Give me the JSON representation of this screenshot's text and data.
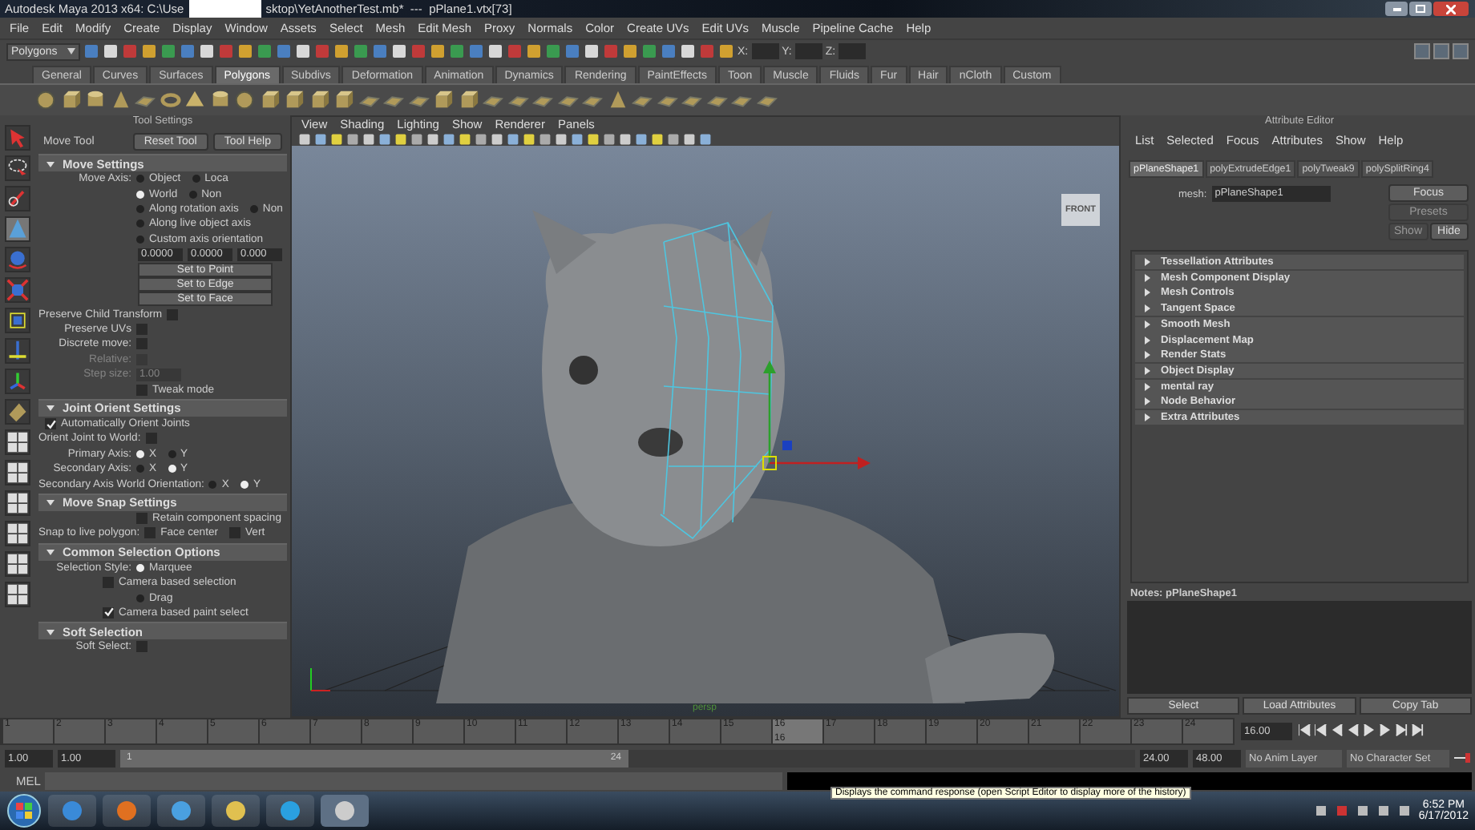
{
  "window": {
    "title_left": "Autodesk Maya 2013 x64: C:\\Use",
    "title_right": "sktop\\YetAnotherTest.mb*  ---  pPlane1.vtx[73]"
  },
  "menu": [
    "File",
    "Edit",
    "Modify",
    "Create",
    "Display",
    "Window",
    "Assets",
    "Select",
    "Mesh",
    "Edit Mesh",
    "Proxy",
    "Normals",
    "Color",
    "Create UVs",
    "Edit UVs",
    "Muscle",
    "Pipeline Cache",
    "Help"
  ],
  "status_line": {
    "mode": "Polygons",
    "coords": [
      "X:",
      "Y:",
      "Z:"
    ]
  },
  "shelf_tabs": [
    {
      "label": "General",
      "selected": false
    },
    {
      "label": "Curves",
      "selected": false
    },
    {
      "label": "Surfaces",
      "selected": false
    },
    {
      "label": "Polygons",
      "selected": true
    },
    {
      "label": "Subdivs",
      "selected": false
    },
    {
      "label": "Deformation",
      "selected": false
    },
    {
      "label": "Animation",
      "selected": false
    },
    {
      "label": "Dynamics",
      "selected": false
    },
    {
      "label": "Rendering",
      "selected": false
    },
    {
      "label": "PaintEffects",
      "selected": false
    },
    {
      "label": "Toon",
      "selected": false
    },
    {
      "label": "Muscle",
      "selected": false
    },
    {
      "label": "Fluids",
      "selected": false
    },
    {
      "label": "Fur",
      "selected": false
    },
    {
      "label": "Hair",
      "selected": false
    },
    {
      "label": "nCloth",
      "selected": false
    },
    {
      "label": "Custom",
      "selected": false
    }
  ],
  "tool_settings": {
    "title": "Tool Settings",
    "tool": "Move Tool",
    "buttons": [
      "Reset Tool",
      "Tool Help"
    ],
    "sections": [
      {
        "title": "Move Settings",
        "expanded": true,
        "rows": [
          {
            "kind": "radio",
            "label": "Move Axis:",
            "options": [
              {
                "text": "Object",
                "selected": false
              },
              {
                "text": "Loca",
                "selected": false
              }
            ]
          },
          {
            "kind": "radio",
            "options": [
              {
                "text": "World",
                "selected": true
              },
              {
                "text": "Non",
                "selected": false
              }
            ]
          },
          {
            "kind": "radio",
            "options": [
              {
                "text": "Along rotation axis",
                "selected": false
              },
              {
                "text": "Non",
                "selected": false
              }
            ]
          },
          {
            "kind": "radio",
            "options": [
              {
                "text": "Along live object axis",
                "selected": false
              }
            ]
          },
          {
            "kind": "radio",
            "options": [
              {
                "text": "Custom axis orientation",
                "selected": false
              }
            ]
          },
          {
            "kind": "fields",
            "values": [
              "0.0000",
              "0.0000",
              "0.000"
            ]
          },
          {
            "kind": "button",
            "text": "Set to Point"
          },
          {
            "kind": "button",
            "text": "Set to Edge"
          },
          {
            "kind": "button",
            "text": "Set to Face"
          },
          {
            "kind": "check",
            "label": "Preserve Child Transform",
            "items": [
              {
                "checked": false
              }
            ]
          },
          {
            "kind": "check",
            "label": "Preserve UVs",
            "items": [
              {
                "checked": false
              }
            ]
          },
          {
            "kind": "check",
            "label": "Discrete move:",
            "items": [
              {
                "checked": false
              }
            ]
          },
          {
            "kind": "check",
            "label": "Relative:",
            "disabled": true,
            "items": [
              {
                "checked": false
              }
            ]
          },
          {
            "kind": "field",
            "label": "Step size:",
            "disabled": true,
            "value": "1.00"
          },
          {
            "kind": "check",
            "items": [
              {
                "text": "Tweak mode",
                "checked": false
              }
            ]
          }
        ]
      },
      {
        "title": "Joint Orient Settings",
        "expanded": true,
        "rows": [
          {
            "kind": "check",
            "wide": true,
            "items": [
              {
                "text": "Automatically Orient Joints",
                "checked": true
              }
            ]
          },
          {
            "kind": "check",
            "label": "Orient Joint to World:",
            "items": [
              {
                "checked": false
              }
            ]
          },
          {
            "kind": "radio",
            "label": "Primary Axis:",
            "options": [
              {
                "text": "X",
                "selected": true
              },
              {
                "text": "Y",
                "selected": false
              }
            ]
          },
          {
            "kind": "radio",
            "label": "Secondary Axis:",
            "options": [
              {
                "text": "X",
                "selected": false
              },
              {
                "text": "Y",
                "selected": true
              }
            ]
          },
          {
            "kind": "radio",
            "label": "Secondary Axis World Orientation:",
            "options": [
              {
                "text": "X",
                "selected": false
              },
              {
                "text": "Y",
                "selected": true
              }
            ]
          }
        ]
      },
      {
        "title": "Move Snap Settings",
        "expanded": true,
        "rows": [
          {
            "kind": "check",
            "items": [
              {
                "text": "Retain component spacing",
                "checked": false
              }
            ]
          },
          {
            "kind": "check",
            "label": "Snap to live polygon:",
            "items": [
              {
                "text": "Face center",
                "checked": false
              },
              {
                "text": "Vert",
                "checked": false
              }
            ]
          }
        ]
      },
      {
        "title": "Common Selection Options",
        "expanded": true,
        "rows": [
          {
            "kind": "radio",
            "label": "Selection Style:",
            "options": [
              {
                "text": "Marquee",
                "selected": true
              }
            ]
          },
          {
            "kind": "check",
            "indent": true,
            "items": [
              {
                "text": "Camera based selection",
                "checked": false
              }
            ]
          },
          {
            "kind": "radio",
            "options": [
              {
                "text": "Drag",
                "selected": false
              }
            ]
          },
          {
            "kind": "check",
            "indent": true,
            "items": [
              {
                "text": "Camera based paint select",
                "checked": true
              }
            ]
          }
        ]
      },
      {
        "title": "Soft Selection",
        "expanded": true,
        "rows": [
          {
            "kind": "check",
            "label": "Soft Select:",
            "items": [
              {
                "checked": false
              }
            ]
          }
        ]
      }
    ]
  },
  "viewport": {
    "menu": [
      "View",
      "Shading",
      "Lighting",
      "Show",
      "Renderer",
      "Panels"
    ],
    "view_cube": "FRONT",
    "camera": "persp"
  },
  "attribute_editor": {
    "title": "Attribute Editor",
    "menu": [
      "List",
      "Selected",
      "Focus",
      "Attributes",
      "Show",
      "Help"
    ],
    "tabs": [
      {
        "label": "pPlaneShape1",
        "selected": true
      },
      {
        "label": "polyExtrudeEdge1",
        "selected": false
      },
      {
        "label": "polyTweak9",
        "selected": false
      },
      {
        "label": "polySplitRing4",
        "selected": false
      }
    ],
    "mesh_label": "mesh:",
    "mesh_value": "pPlaneShape1",
    "side_buttons": [
      {
        "label": "Focus",
        "disabled": false
      },
      {
        "label": "Presets",
        "disabled": true
      },
      {
        "label": "Show",
        "disabled": true
      },
      {
        "label": "Hide",
        "disabled": false
      }
    ],
    "sections": [
      {
        "title": "Tessellation Attributes",
        "expanded": false
      },
      {
        "title": "Mesh Component Display",
        "expanded": false
      },
      {
        "title": "Mesh Controls",
        "expanded": false
      },
      {
        "title": "Tangent Space",
        "expanded": false
      },
      {
        "title": "Smooth Mesh",
        "expanded": false
      },
      {
        "title": "Displacement Map",
        "expanded": false
      },
      {
        "title": "Render Stats",
        "expanded": false
      },
      {
        "title": "Object Display",
        "expanded": false
      },
      {
        "title": "mental ray",
        "expanded": false
      },
      {
        "title": "Node Behavior",
        "expanded": false
      },
      {
        "title": "Extra Attributes",
        "expanded": false
      }
    ],
    "notes_label": "Notes:  pPlaneShape1",
    "buttons": [
      "Select",
      "Load Attributes",
      "Copy Tab"
    ]
  },
  "timeline": {
    "ticks": [
      {
        "label": "1",
        "selected": false
      },
      {
        "label": "2",
        "selected": false
      },
      {
        "label": "3",
        "selected": false
      },
      {
        "label": "4",
        "selected": false
      },
      {
        "label": "5",
        "selected": false
      },
      {
        "label": "6",
        "selected": false
      },
      {
        "label": "7",
        "selected": false
      },
      {
        "label": "8",
        "selected": false
      },
      {
        "label": "9",
        "selected": false
      },
      {
        "label": "10",
        "selected": false
      },
      {
        "label": "11",
        "selected": false
      },
      {
        "label": "12",
        "selected": false
      },
      {
        "label": "13",
        "selected": false
      },
      {
        "label": "14",
        "selected": false
      },
      {
        "label": "15",
        "selected": false
      },
      {
        "label": "16",
        "selected": true
      },
      {
        "label": "17",
        "selected": false
      },
      {
        "label": "18",
        "selected": false
      },
      {
        "label": "19",
        "selected": false
      },
      {
        "label": "20",
        "selected": false
      },
      {
        "label": "21",
        "selected": false
      },
      {
        "label": "22",
        "selected": false
      },
      {
        "label": "23",
        "selected": false
      },
      {
        "label": "24",
        "selected": false
      }
    ],
    "current_label": "16",
    "time_field": "16.00"
  },
  "range": {
    "start": "1.00",
    "start_playback": "1.00",
    "slider_start": "1",
    "level": 0.5,
    "slider_end": "24",
    "end_playback": "24.00",
    "end": "48.00",
    "anim_layer": "No Anim Layer",
    "character_set": "No Character Set"
  },
  "command_line": {
    "language": "MEL",
    "tooltip": "Displays the command response (open Script Editor to display more of the history)"
  },
  "taskbar": {
    "time": "6:52 PM",
    "date": "6/17/2012"
  }
}
